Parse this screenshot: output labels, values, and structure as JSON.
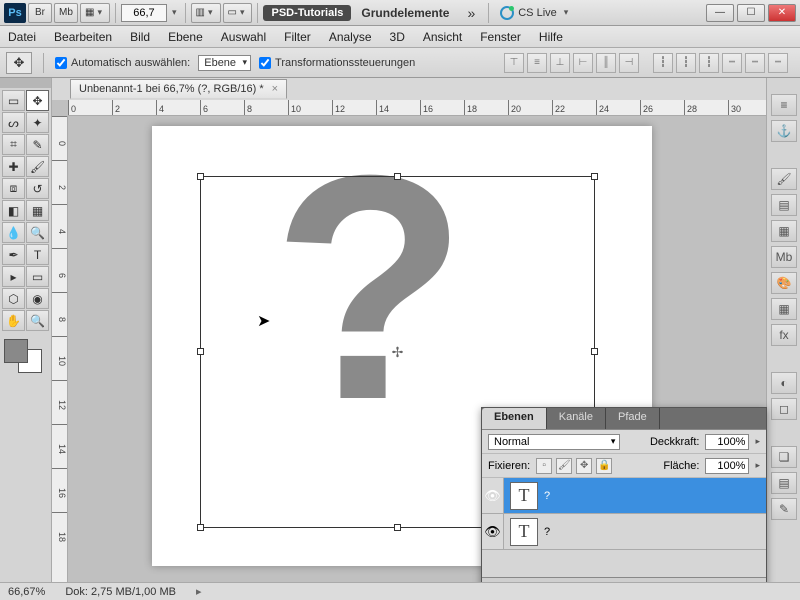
{
  "top": {
    "ps": "Ps",
    "br": "Br",
    "mb": "Mb",
    "zoom_display": "66,7",
    "tutorials": "PSD-Tutorials",
    "workspace": "Grundelemente",
    "cslive": "CS Live"
  },
  "menu": [
    "Datei",
    "Bearbeiten",
    "Bild",
    "Ebene",
    "Auswahl",
    "Filter",
    "Analyse",
    "3D",
    "Ansicht",
    "Fenster",
    "Hilfe"
  ],
  "options": {
    "auto_select_label": "Automatisch auswählen:",
    "auto_select_target": "Ebene",
    "transform_label": "Transformationssteuerungen"
  },
  "document": {
    "tab_title": "Unbenannt-1 bei 66,7% (?, RGB/16) *"
  },
  "ruler_h": [
    0,
    2,
    4,
    6,
    8,
    10,
    12,
    14,
    16,
    18,
    20,
    22,
    24,
    26,
    28,
    30
  ],
  "ruler_v": [
    0,
    2,
    4,
    6,
    8,
    10,
    12,
    14,
    16,
    18
  ],
  "canvas": {
    "placeholder": "?"
  },
  "layers": {
    "tabs": [
      "Ebenen",
      "Kanäle",
      "Pfade"
    ],
    "blend_mode": "Normal",
    "opacity_label": "Deckkraft:",
    "opacity": "100%",
    "lock_label": "Fixieren:",
    "fill_label": "Fläche:",
    "fill": "100%",
    "items": [
      {
        "visible": true,
        "thumb": "T",
        "name": "?",
        "selected": true
      },
      {
        "visible": true,
        "thumb": "T",
        "name": "?",
        "selected": false
      }
    ]
  },
  "status": {
    "zoom": "66,67%",
    "doc": "Dok: 2,75 MB/1,00 MB"
  }
}
